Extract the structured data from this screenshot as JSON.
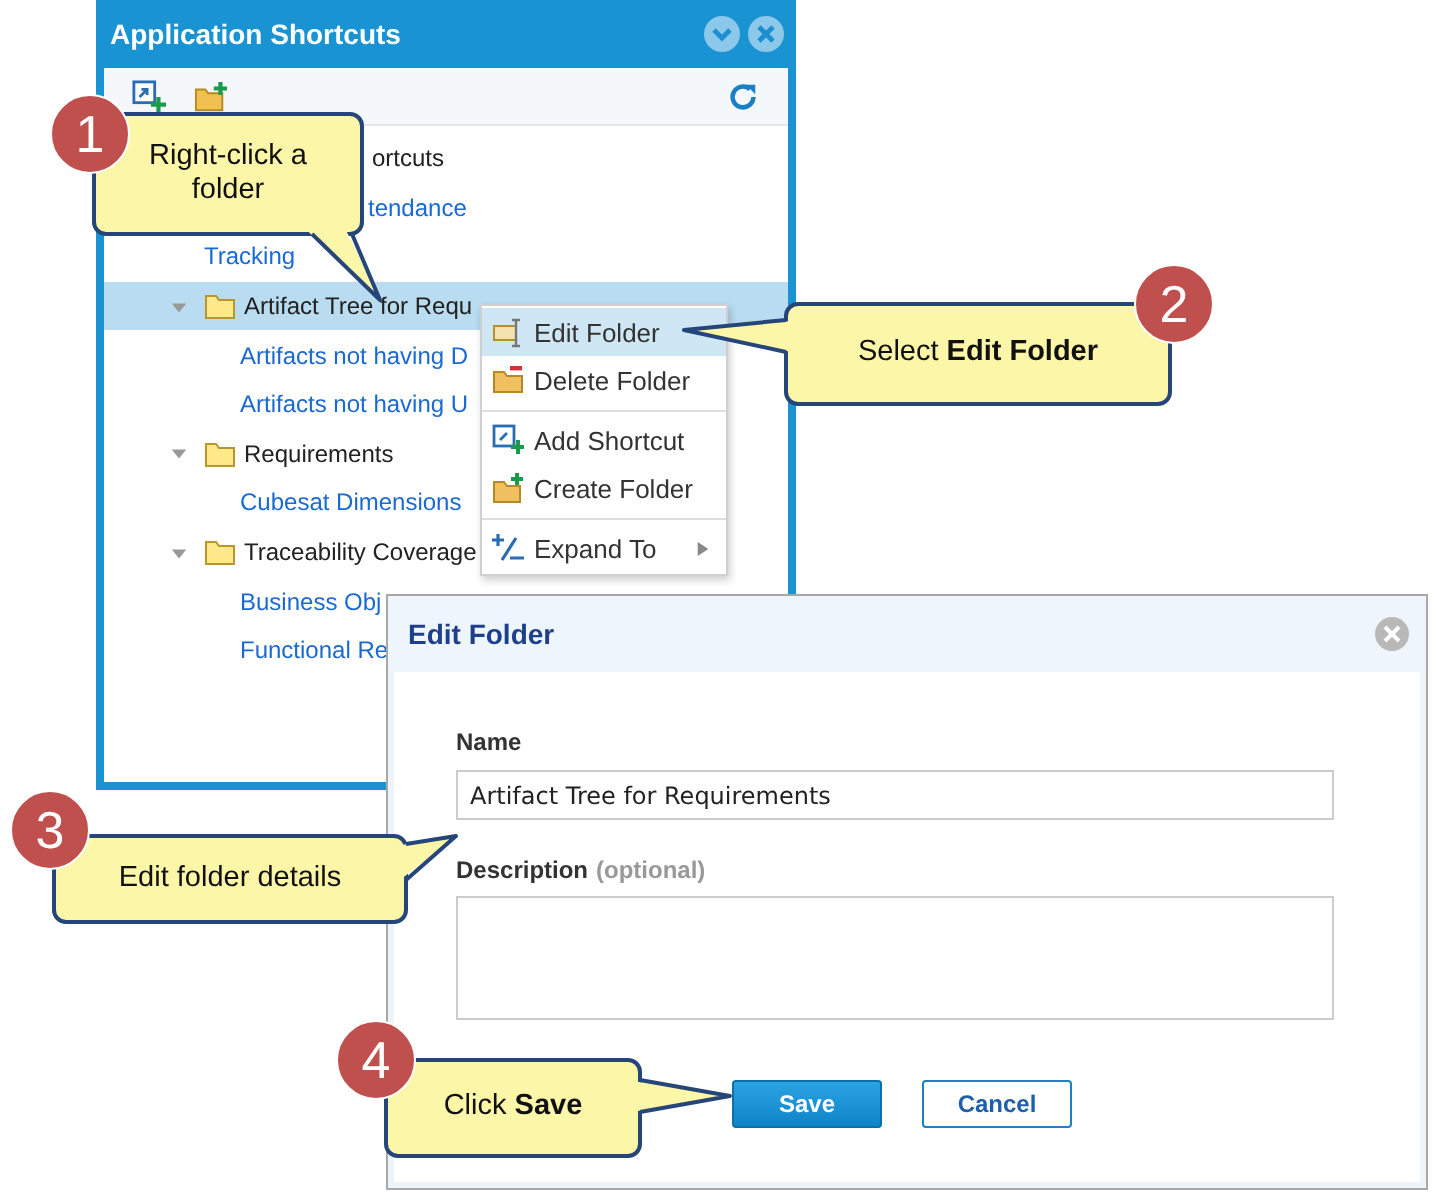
{
  "panel": {
    "title": "Application Shortcuts",
    "tree": [
      {
        "label": "ortcuts",
        "selected": false,
        "children": [
          {
            "label": "tendance"
          },
          {
            "label": "Tracking"
          }
        ]
      },
      {
        "label": "Artifact Tree for Requ",
        "expanded": true,
        "selected": true,
        "children": [
          {
            "label": "Artifacts not having D"
          },
          {
            "label": "Artifacts not having U"
          }
        ]
      },
      {
        "label": "Requirements",
        "expanded": true,
        "selected": false,
        "children": [
          {
            "label": "Cubesat Dimensions"
          }
        ]
      },
      {
        "label": "Traceability Coverage",
        "expanded": true,
        "selected": false,
        "children": [
          {
            "label": "Business Obj"
          },
          {
            "label": "Functional Re"
          }
        ]
      }
    ]
  },
  "context_menu": {
    "items": [
      {
        "label": "Edit Folder",
        "selected": true,
        "divider_above": false,
        "submenu": false
      },
      {
        "label": "Delete Folder",
        "selected": false,
        "divider_above": false,
        "submenu": false
      },
      {
        "label": "Add Shortcut",
        "selected": false,
        "divider_above": true,
        "submenu": false
      },
      {
        "label": "Create Folder",
        "selected": false,
        "divider_above": false,
        "submenu": false
      },
      {
        "label": "Expand To",
        "selected": false,
        "divider_above": true,
        "submenu": true
      }
    ]
  },
  "dialog": {
    "title": "Edit Folder",
    "name_label": "Name",
    "name_value": "Artifact Tree for Requirements",
    "description_label": "Description",
    "description_hint": "(optional)",
    "buttons": [
      {
        "label": "Save",
        "kind": "primary"
      },
      {
        "label": "Cancel",
        "kind": "secondary"
      }
    ]
  },
  "callouts": [
    {
      "number": "1",
      "text": "Right-click a folder"
    },
    {
      "number": "2",
      "text": "Select **Edit Folder**"
    },
    {
      "number": "3",
      "text": "Edit folder details"
    },
    {
      "number": "4",
      "text": "Click **Save**"
    }
  ]
}
